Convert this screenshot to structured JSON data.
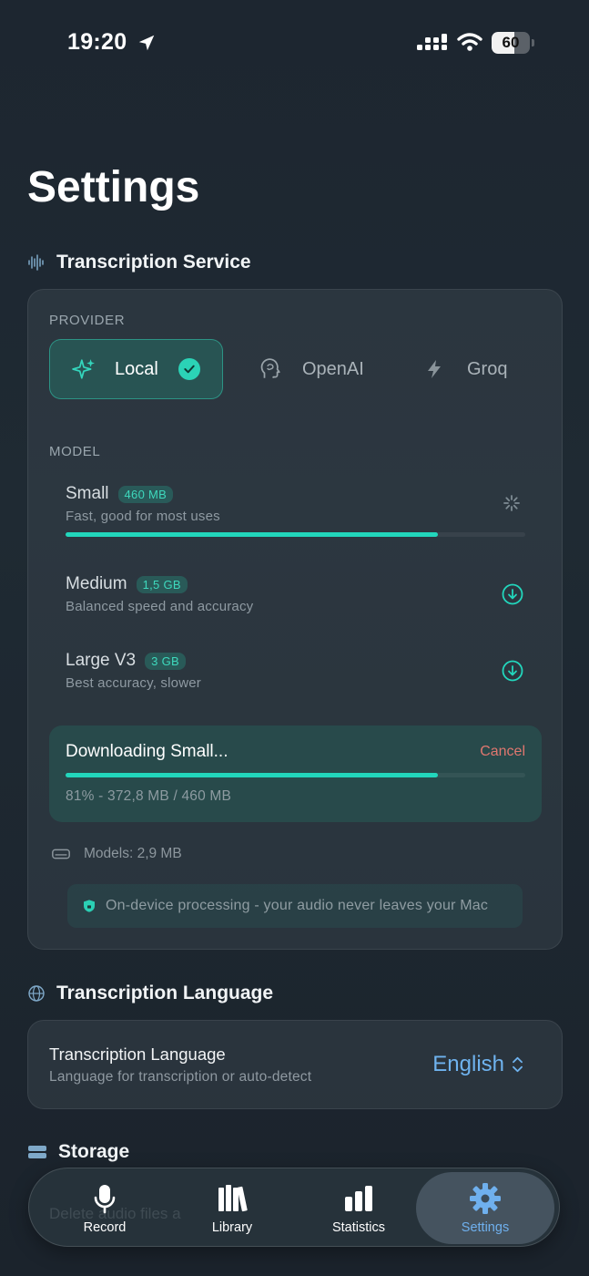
{
  "status_bar": {
    "time": "19:20",
    "battery": "60"
  },
  "page": {
    "title": "Settings"
  },
  "transcription_service": {
    "section_title": "Transcription Service",
    "provider_caption": "PROVIDER",
    "providers": [
      {
        "name": "Local",
        "selected": true
      },
      {
        "name": "OpenAI",
        "selected": false
      },
      {
        "name": "Groq",
        "selected": false
      }
    ],
    "model_caption": "MODEL",
    "models": [
      {
        "name": "Small",
        "size": "460 MB",
        "description": "Fast, good for most uses",
        "state": "downloading",
        "progress": 0.81
      },
      {
        "name": "Medium",
        "size": "1,5 GB",
        "description": "Balanced speed and accuracy",
        "state": "available"
      },
      {
        "name": "Large V3",
        "size": "3 GB",
        "description": "Best accuracy, slower",
        "state": "available"
      }
    ],
    "download": {
      "title": "Downloading Small...",
      "cancel_label": "Cancel",
      "progress": 0.81,
      "status": "81% - 372,8 MB / 460 MB"
    },
    "models_storage": "Models: 2,9 MB",
    "privacy_note": "On-device processing - your audio never leaves your Mac"
  },
  "transcription_language": {
    "section_title": "Transcription Language",
    "row_title": "Transcription Language",
    "row_subtitle": "Language for transcription or auto-detect",
    "value": "English"
  },
  "storage": {
    "section_title": "Storage",
    "partial_text": "Delete audio files a"
  },
  "tab_bar": {
    "tabs": [
      {
        "label": "Record",
        "icon": "microphone-icon",
        "active": false
      },
      {
        "label": "Library",
        "icon": "books-icon",
        "active": false
      },
      {
        "label": "Statistics",
        "icon": "bar-chart-icon",
        "active": false
      },
      {
        "label": "Settings",
        "icon": "gear-icon",
        "active": true
      }
    ]
  },
  "colors": {
    "accent_teal": "#22d6bc",
    "accent_blue": "#6fb3ef",
    "cancel_red": "#e0776f",
    "background": "#1f2a33"
  }
}
